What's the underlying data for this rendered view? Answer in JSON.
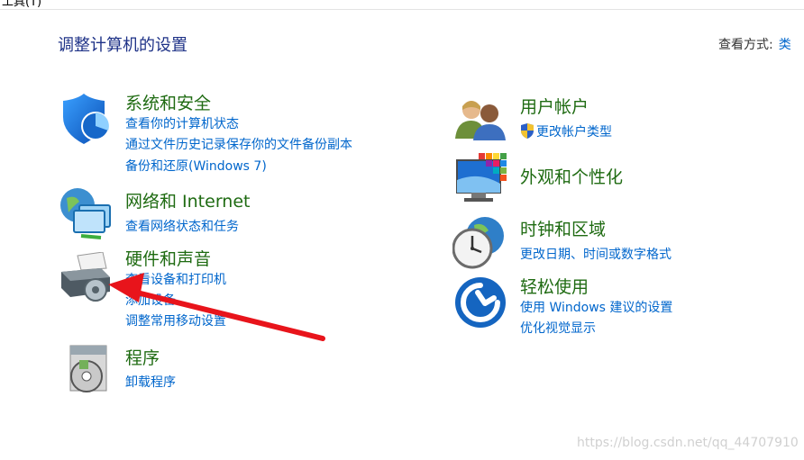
{
  "menubar": {
    "text": "工具(T)"
  },
  "page_title": "调整计算机的设置",
  "view_by": {
    "label": "查看方式:",
    "value": "类"
  },
  "categories": {
    "system_security": {
      "title": "系统和安全",
      "links": [
        "查看你的计算机状态",
        "通过文件历史记录保存你的文件备份副本",
        "备份和还原(Windows 7)"
      ],
      "icon": "shield-icon"
    },
    "network": {
      "title": "网络和 Internet",
      "links": [
        "查看网络状态和任务"
      ],
      "icon": "network-globe-icon"
    },
    "hardware": {
      "title": "硬件和声音",
      "links": [
        "查看设备和打印机",
        "添加设备",
        "调整常用移动设置"
      ],
      "icon": "printer-icon"
    },
    "programs": {
      "title": "程序",
      "links": [
        "卸载程序"
      ],
      "icon": "programs-disc-icon"
    },
    "user_accounts": {
      "title": "用户帐户",
      "links": [
        "更改帐户类型"
      ],
      "icon": "users-icon"
    },
    "appearance": {
      "title": "外观和个性化",
      "links": [],
      "icon": "monitor-palette-icon"
    },
    "clock_region": {
      "title": "时钟和区域",
      "links": [
        "更改日期、时间或数字格式"
      ],
      "icon": "clock-globe-icon"
    },
    "ease_access": {
      "title": "轻松使用",
      "links": [
        "使用 Windows 建议的设置",
        "优化视觉显示"
      ],
      "icon": "ease-of-access-icon"
    }
  },
  "watermark": "https://blog.csdn.net/qq_44707910",
  "annotation": {
    "color": "#e8141b"
  }
}
